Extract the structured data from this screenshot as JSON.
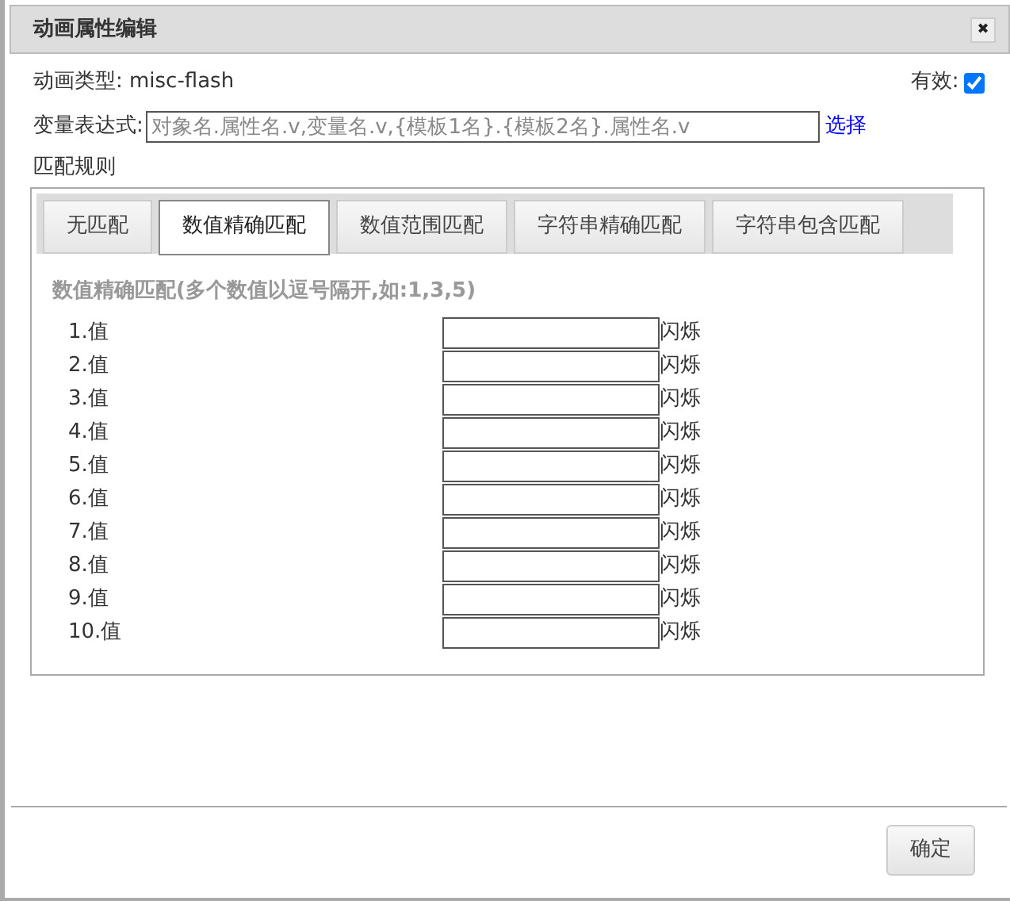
{
  "window": {
    "title": "动画属性编辑",
    "close": "✖"
  },
  "type_row": {
    "label": "动画类型:",
    "value": "misc-flash"
  },
  "valid": {
    "label": "有效:",
    "checked": true
  },
  "expression": {
    "label": "变量表达式:",
    "placeholder": "对象名.属性名.v,变量名.v,{模板1名}.{模板2名}.属性名.v",
    "link": "选择"
  },
  "rules_label": "匹配规则",
  "tabs": [
    {
      "label": "无匹配",
      "selected": false
    },
    {
      "label": "数值精确匹配",
      "selected": true
    },
    {
      "label": "数值范围匹配",
      "selected": false
    },
    {
      "label": "字符串精确匹配",
      "selected": false
    },
    {
      "label": "字符串包含匹配",
      "selected": false
    }
  ],
  "hint": "数值精确匹配(多个数值以逗号隔开,如:1,3,5)",
  "rows": [
    {
      "label": "1.值",
      "suffix": "闪烁"
    },
    {
      "label": "2.值",
      "suffix": "闪烁"
    },
    {
      "label": "3.值",
      "suffix": "闪烁"
    },
    {
      "label": "4.值",
      "suffix": "闪烁"
    },
    {
      "label": "5.值",
      "suffix": "闪烁"
    },
    {
      "label": "6.值",
      "suffix": "闪烁"
    },
    {
      "label": "7.值",
      "suffix": "闪烁"
    },
    {
      "label": "8.值",
      "suffix": "闪烁"
    },
    {
      "label": "9.值",
      "suffix": "闪烁"
    },
    {
      "label": "10.值",
      "suffix": "闪烁"
    }
  ],
  "buttons": [
    "确定"
  ]
}
